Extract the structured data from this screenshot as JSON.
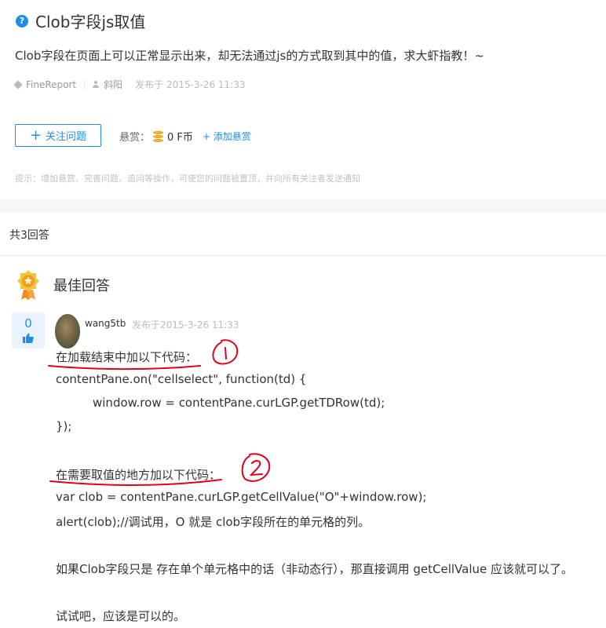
{
  "question": {
    "icon": "question-circle-icon",
    "title": "Clob字段js取值",
    "body": "Clob字段在页面上可以正常显示出来，却无法通过js的方式取到其中的值，求大虾指教！~",
    "tag": "FineReport",
    "author": "斜阳",
    "posted": "发布于 2015-3-26 11:33",
    "follow_label": "关注问题",
    "reward_label": "悬赏：",
    "reward_amount": "0 F币",
    "add_reward_label": "+ 添加悬赏",
    "hint": "提示：增加悬赏、完善问题、追问等操作，可使您的问题被置顶，并向所有关注者发送通知"
  },
  "answers": {
    "count_label": "共3回答",
    "best_label": "最佳回答",
    "best": {
      "votes": "0",
      "author": "wang5tb",
      "posted": "发布于2015-3-26 11:33",
      "lines": [
        "在加载结束中加以下代码：",
        "contentPane.on(\"cellselect\", function(td) {",
        "window.row = contentPane.curLGP.getTDRow(td);",
        "});",
        "在需要取值的地方加以下代码：",
        "var clob = contentPane.curLGP.getCellValue(\"O\"+window.row);",
        "alert(clob);//调试用，O 就是 clob字段所在的单元格的列。",
        "如果Clob字段只是 存在单个单元格中的话（非动态行），那直接调用 getCellValue 应该就可以了。",
        "试试吧，应该是可以的。"
      ]
    }
  },
  "colors": {
    "accent": "#1f8ceb",
    "annotation": "#e0001b"
  }
}
